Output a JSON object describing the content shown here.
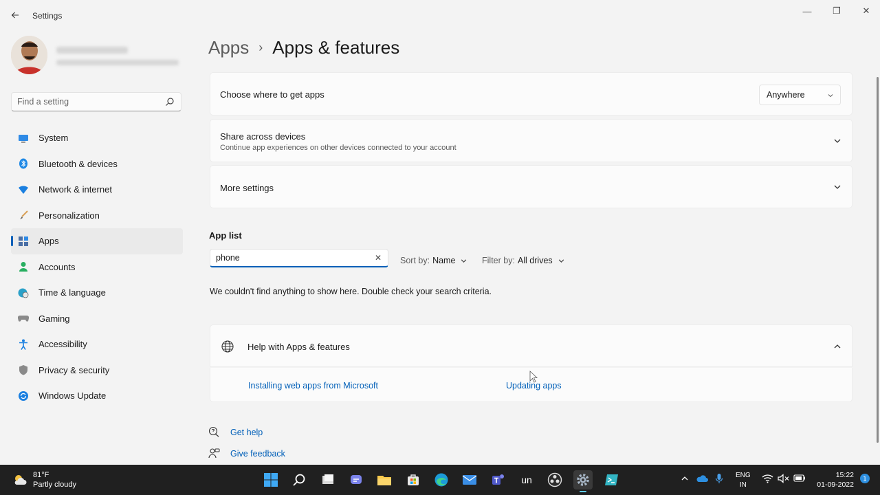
{
  "window": {
    "title": "Settings",
    "minimize_glyph": "—",
    "maximize_glyph": "❐",
    "close_glyph": "✕"
  },
  "sidebar": {
    "search_placeholder": "Find a setting",
    "items": [
      {
        "label": "System",
        "icon": "system-icon"
      },
      {
        "label": "Bluetooth & devices",
        "icon": "bluetooth-icon"
      },
      {
        "label": "Network & internet",
        "icon": "wifi-icon"
      },
      {
        "label": "Personalization",
        "icon": "brush-icon"
      },
      {
        "label": "Apps",
        "icon": "apps-icon",
        "active": true
      },
      {
        "label": "Accounts",
        "icon": "person-icon"
      },
      {
        "label": "Time & language",
        "icon": "globe-clock-icon"
      },
      {
        "label": "Gaming",
        "icon": "controller-icon"
      },
      {
        "label": "Accessibility",
        "icon": "accessibility-icon"
      },
      {
        "label": "Privacy & security",
        "icon": "shield-icon"
      },
      {
        "label": "Windows Update",
        "icon": "update-icon"
      }
    ]
  },
  "header": {
    "parent": "Apps",
    "separator": "›",
    "current": "Apps & features"
  },
  "settings": {
    "choose_apps": {
      "title": "Choose where to get apps",
      "value": "Anywhere"
    },
    "share": {
      "title": "Share across devices",
      "subtitle": "Continue app experiences on other devices connected to your account"
    },
    "more": {
      "title": "More settings"
    }
  },
  "app_list": {
    "label": "App list",
    "search_value": "phone",
    "clear_glyph": "✕",
    "sort_label": "Sort by:",
    "sort_value": "Name",
    "filter_label": "Filter by:",
    "filter_value": "All drives",
    "empty_message": "We couldn't find anything to show here. Double check your search criteria."
  },
  "help": {
    "title": "Help with Apps & features",
    "links": [
      "Installing web apps from Microsoft",
      "Updating apps"
    ]
  },
  "footer_links": {
    "get_help": "Get help",
    "feedback": "Give feedback"
  },
  "taskbar": {
    "weather_temp": "81°F",
    "weather_desc": "Partly cloudy",
    "search_app_label": "un",
    "lang_line1": "ENG",
    "lang_line2": "IN",
    "time": "15:22",
    "date": "01-09-2022"
  },
  "colors": {
    "accent": "#005fb8",
    "taskbar": "#202020",
    "background": "#f3f3f3"
  }
}
